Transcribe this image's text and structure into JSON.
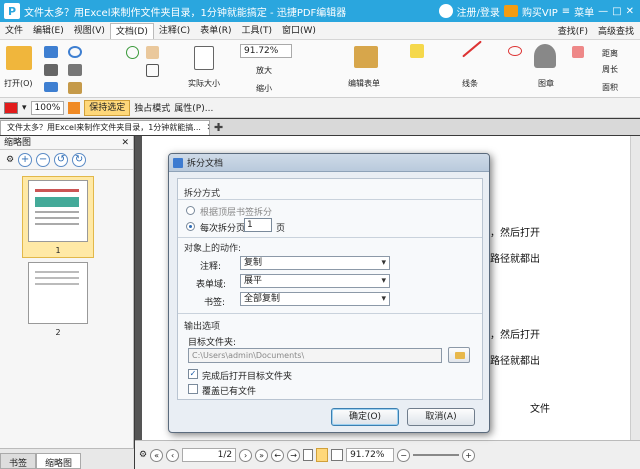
{
  "window": {
    "title": "文件太多？用Excel来制作文件夹目录，1分钟就能搞定 - 迅捷PDF编辑器",
    "logo": "P",
    "login": "注册/登录",
    "vip": "购买VIP",
    "menu": "菜单"
  },
  "menubar": {
    "items": [
      "文件",
      "编辑(E)",
      "视图(V)",
      "文档(D)",
      "注释(C)",
      "表单(R)",
      "工具(T)",
      "窗口(W)"
    ],
    "active_index": 3,
    "find": "查找(F)",
    "advanced_find": "高级查找"
  },
  "ribbon": {
    "open": "打开(O)",
    "actual_size": "实际大小",
    "zoom_value": "91.72%",
    "zoom_in": "放大",
    "zoom_out": "缩小",
    "edit_form": "编辑表单",
    "lines": "线条",
    "stamp": "图章",
    "distance": "距离",
    "perimeter": "周长",
    "area": "面积"
  },
  "toolbar2": {
    "zoom": "100%",
    "keep_select": "保持选定",
    "exclusive_mode": "独占模式",
    "properties": "属性(P)...",
    "accent": "#e21b1b"
  },
  "tabs": [
    {
      "label": "文件太多？用Excel来制作文件夹目录，1分钟就能搞..."
    }
  ],
  "left_panel": {
    "title": "缩略图",
    "pages": [
      "1",
      "2"
    ],
    "bottom_tabs": [
      "书签",
      "缩略图"
    ]
  },
  "page_text": [
    "制，然后打开",
    "的路径就都出",
    "制，然后打开",
    "的路径就都出",
    "文件"
  ],
  "status": {
    "page": "1/2",
    "zoom": "91.72%"
  },
  "dialog": {
    "title": "拆分文档",
    "split_group": "拆分方式",
    "by_bookmark": "根据顶层书签拆分",
    "by_pages": "每次拆分页数",
    "pages_value": "1",
    "pages_unit": "页",
    "actions_group": "对象上的动作:",
    "comment_label": "注释:",
    "comment_value": "复制",
    "form_label": "表单域:",
    "form_value": "展平",
    "bookmark_label": "书签:",
    "bookmark_value": "全部复制",
    "output_group": "输出选项",
    "target_folder": "目标文件夹:",
    "folder_path": "C:\\Users\\admin\\Documents\\",
    "open_after": "完成后打开目标文件夹",
    "overwrite": "覆盖已有文件",
    "ok": "确定(O)",
    "cancel": "取消(A)"
  }
}
